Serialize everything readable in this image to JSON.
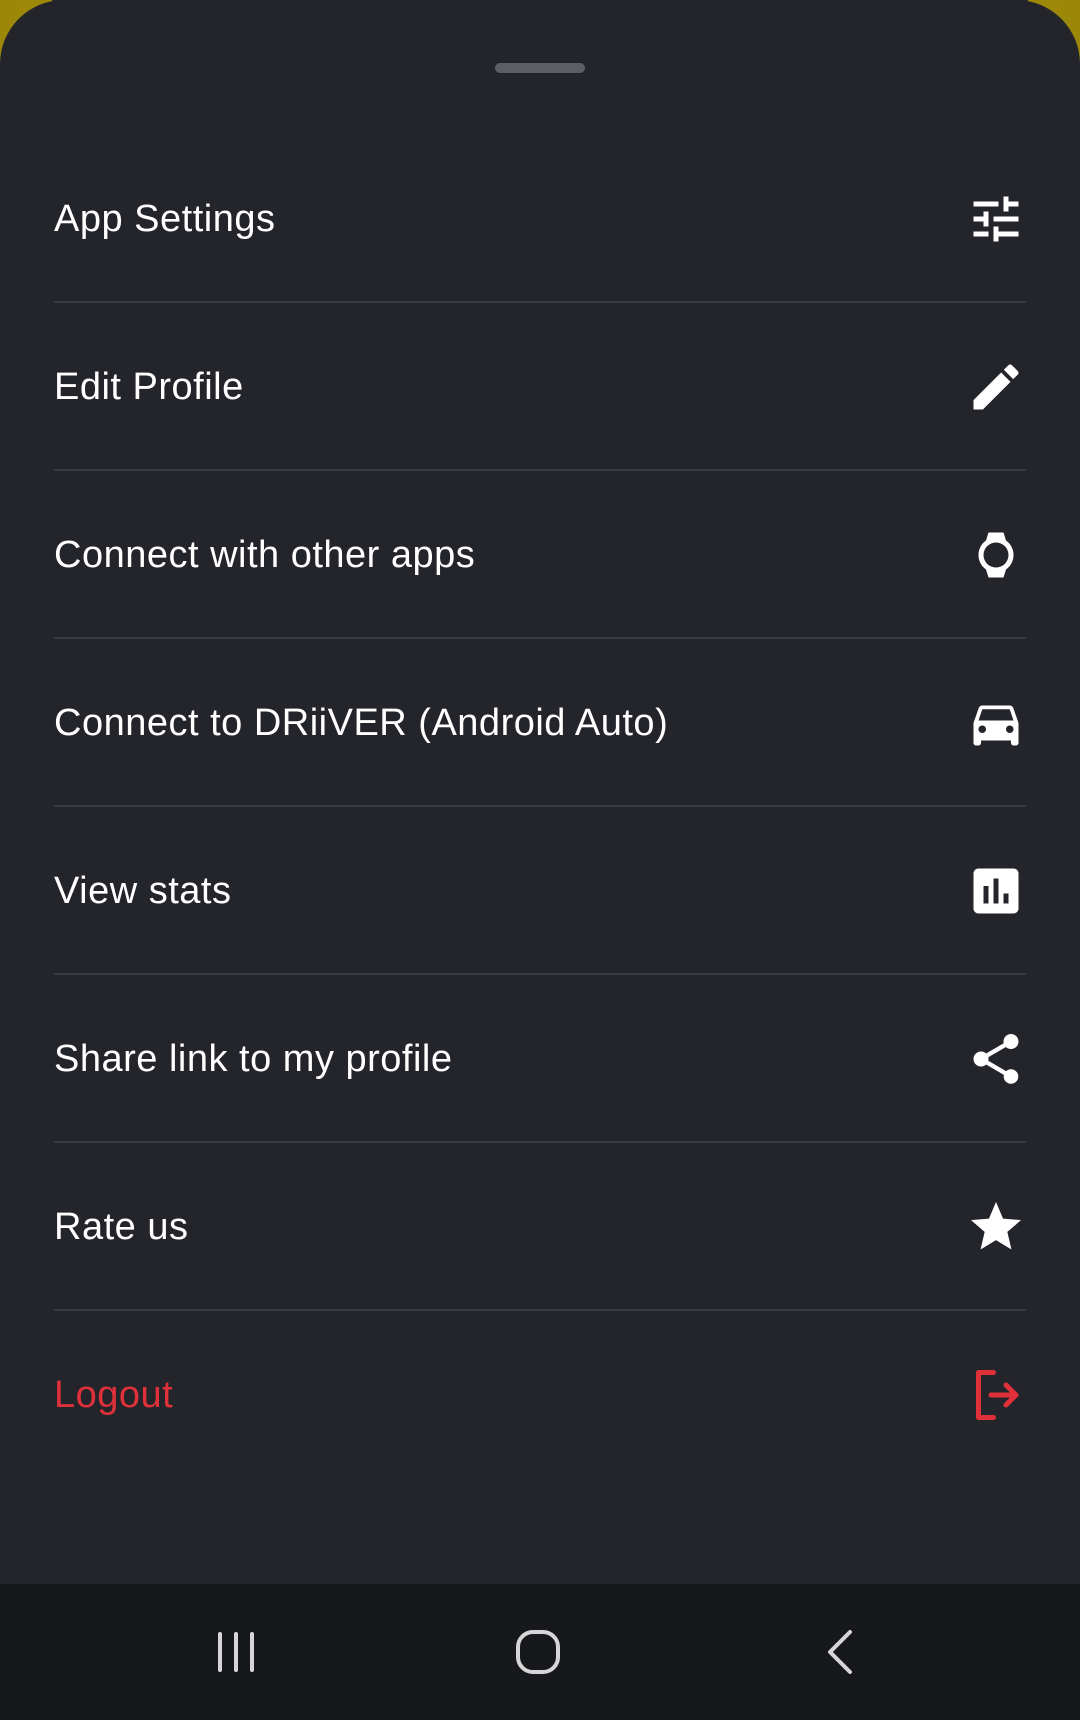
{
  "menu": {
    "items": [
      {
        "label": "App Settings",
        "icon": "tune-sliders-icon"
      },
      {
        "label": "Edit Profile",
        "icon": "pencil-icon"
      },
      {
        "label": "Connect with other apps",
        "icon": "smartwatch-icon"
      },
      {
        "label": "Connect to DRiiVER (Android Auto)",
        "icon": "car-icon"
      },
      {
        "label": "View stats",
        "icon": "bar-chart-icon"
      },
      {
        "label": "Share link to my profile",
        "icon": "share-icon"
      },
      {
        "label": "Rate us",
        "icon": "star-icon"
      },
      {
        "label": "Logout",
        "icon": "logout-icon"
      }
    ]
  },
  "colors": {
    "sheet_background": "#24252b",
    "text_primary": "#ffffff",
    "danger": "#e0303a",
    "divider": "#3a3b41",
    "backdrop_accent": "#a8920a",
    "navbar": "#17181c"
  },
  "navbar": {
    "buttons": [
      "recent-apps-icon",
      "home-icon",
      "back-icon"
    ]
  }
}
